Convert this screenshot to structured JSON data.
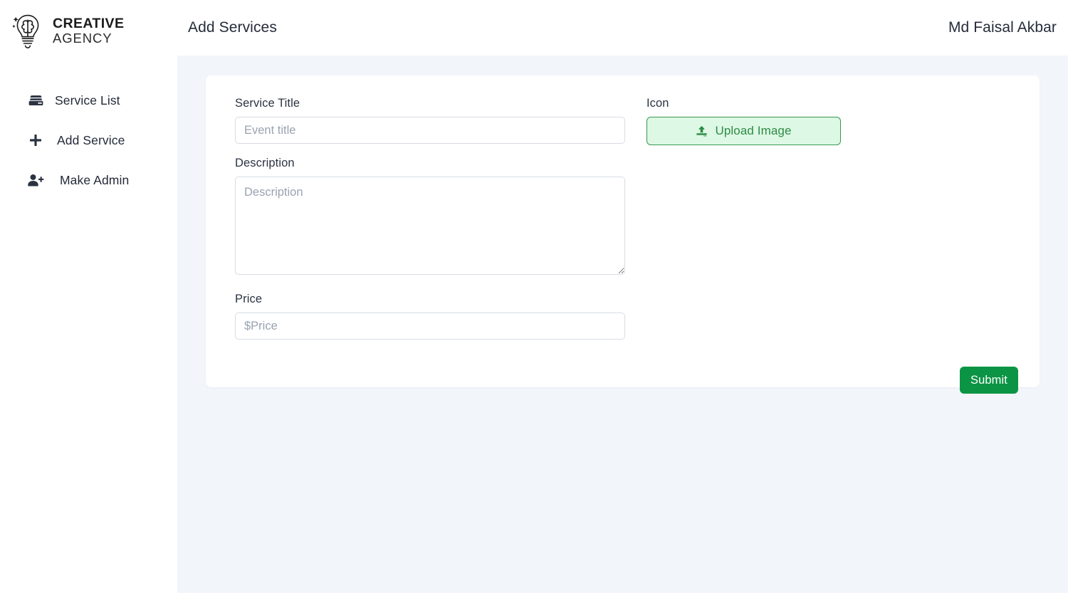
{
  "brand": {
    "logo_icon": "brain-lightbulb-icon",
    "line1": "CREATIVE",
    "line2": "AGENCY"
  },
  "sidebar": {
    "items": [
      {
        "label": "Service List",
        "icon": "server-icon"
      },
      {
        "label": "Add Service",
        "icon": "plus-icon"
      },
      {
        "label": "Make Admin",
        "icon": "user-plus-icon"
      }
    ]
  },
  "header": {
    "title": "Add Services",
    "user_name": "Md Faisal Akbar"
  },
  "form": {
    "service_title": {
      "label": "Service Title",
      "value": "",
      "placeholder": "Event title"
    },
    "description": {
      "label": "Description",
      "value": "",
      "placeholder": "Description"
    },
    "price": {
      "label": "Price",
      "value": "",
      "placeholder": "$Price"
    },
    "icon_field": {
      "label": "Icon",
      "upload_label": "Upload Image",
      "upload_icon": "upload-icon"
    },
    "submit_label": "Submit"
  },
  "colors": {
    "accent_green": "#0b9444",
    "upload_bg": "#ddf8e4",
    "upload_border": "#36994d",
    "upload_text": "#2e8b46",
    "content_bg": "#f2f5fa",
    "input_border": "#d7dce3",
    "text": "#2b3342"
  }
}
